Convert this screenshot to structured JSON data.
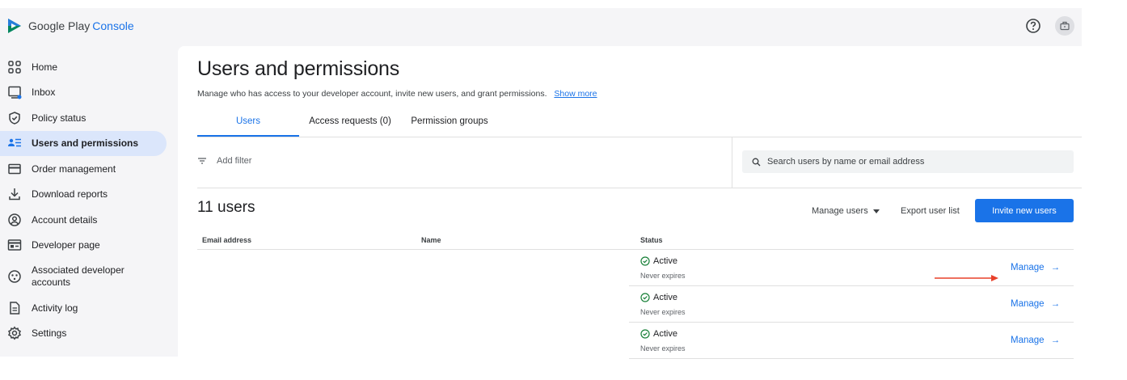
{
  "header": {
    "brand_google_play": "Google Play",
    "brand_console": "Console"
  },
  "sidebar": {
    "items": [
      {
        "label": "Home",
        "icon": "home-grid-icon"
      },
      {
        "label": "Inbox",
        "icon": "inbox-icon"
      },
      {
        "label": "Policy status",
        "icon": "shield-check-icon"
      },
      {
        "label": "Users and permissions",
        "icon": "users-list-icon",
        "active": true
      },
      {
        "label": "Order management",
        "icon": "card-icon"
      },
      {
        "label": "Download reports",
        "icon": "download-icon"
      },
      {
        "label": "Account details",
        "icon": "account-circle-icon"
      },
      {
        "label": "Developer page",
        "icon": "web-page-icon"
      },
      {
        "label": "Associated developer accounts",
        "icon": "linked-accounts-icon"
      },
      {
        "label": "Activity log",
        "icon": "document-icon"
      },
      {
        "label": "Settings",
        "icon": "gear-icon"
      }
    ]
  },
  "page": {
    "title": "Users and permissions",
    "description": "Manage who has access to your developer account, invite new users, and grant permissions.",
    "show_more": "Show more"
  },
  "tabs": [
    "Users",
    "Access requests (0)",
    "Permission groups"
  ],
  "filter": {
    "add_filter": "Add filter",
    "search_placeholder": "Search users by name or email address"
  },
  "users": {
    "count_label": "11 users",
    "manage_users": "Manage users",
    "export": "Export user list",
    "invite": "Invite new users",
    "columns": [
      "Email address",
      "Name",
      "Status"
    ],
    "rows": [
      {
        "status": "Active",
        "expires": "Never expires",
        "action": "Manage"
      },
      {
        "status": "Active",
        "expires": "Never expires",
        "action": "Manage"
      },
      {
        "status": "Active",
        "expires": "Never expires",
        "action": "Manage"
      }
    ]
  },
  "colors": {
    "accent": "#1a73e8",
    "active_nav_bg": "#dbe6fb",
    "status_green": "#188038",
    "annotation_arrow": "#e8402a"
  }
}
